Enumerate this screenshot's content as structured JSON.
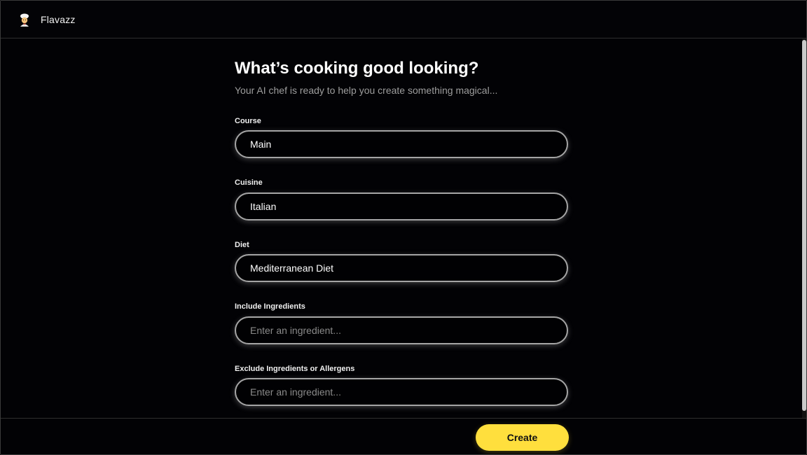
{
  "header": {
    "app_name": "Flavazz",
    "logo_icon": "chef-emoji-icon"
  },
  "main": {
    "title": "What’s cooking good looking?",
    "subtitle": "Your AI chef is ready to help you create something magical...",
    "fields": [
      {
        "label": "Course",
        "value": "Main",
        "placeholder": ""
      },
      {
        "label": "Cuisine",
        "value": "Italian",
        "placeholder": ""
      },
      {
        "label": "Diet",
        "value": "Mediterranean Diet",
        "placeholder": ""
      },
      {
        "label": "Include Ingredients",
        "value": "",
        "placeholder": "Enter an ingredient..."
      },
      {
        "label": "Exclude Ingredients or Allergens",
        "value": "",
        "placeholder": "Enter an ingredient..."
      }
    ]
  },
  "footer": {
    "create_label": "Create"
  },
  "colors": {
    "accent": "#ffdf3d",
    "background": "#020205",
    "field_border": "#a5a5a5"
  }
}
